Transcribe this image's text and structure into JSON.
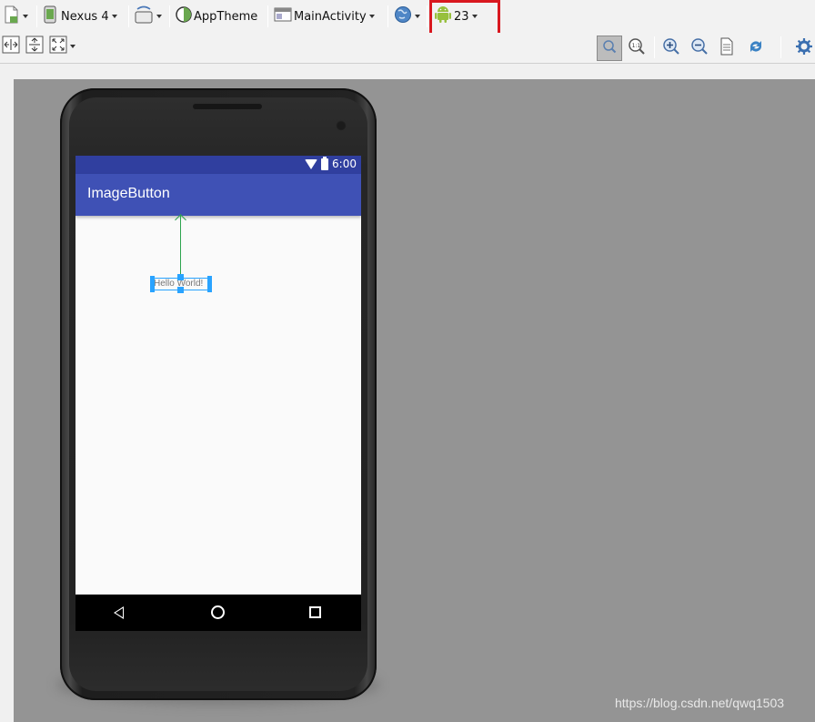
{
  "toolbar": {
    "device_label": "Nexus 4",
    "theme_label": "AppTheme",
    "activity_label": "MainActivity",
    "api_level_label": "23",
    "icons": [
      "new-layout-icon",
      "device-icon",
      "orientation-icon",
      "theme-icon",
      "activity-icon",
      "locale-icon",
      "android-icon"
    ],
    "row2_icons": [
      "expand-horizontal-icon",
      "expand-vertical-icon",
      "fill-icon",
      "zoom-actual-icon",
      "zoom-fit-icon",
      "zoom-in-icon",
      "zoom-out-icon",
      "refresh-icon",
      "rendering-icon",
      "settings-icon"
    ]
  },
  "highlight": {
    "color": "#d9181f"
  },
  "device": {
    "status_time": "6:00",
    "app_title": "ImageButton",
    "selected_view_text": "Hello World!",
    "colors": {
      "status_bar": "#303f9f",
      "app_bar": "#3f51b5",
      "selection": "#29a3ff",
      "constraint": "#2da44e"
    }
  },
  "watermark": "https://blog.csdn.net/qwq1503"
}
